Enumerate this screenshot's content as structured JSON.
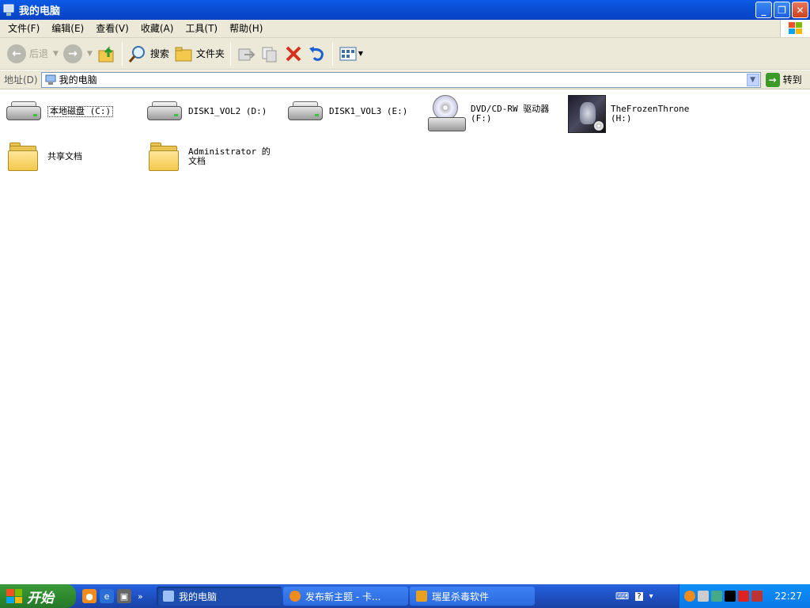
{
  "window": {
    "title": "我的电脑"
  },
  "menu": [
    "文件(F)",
    "编辑(E)",
    "查看(V)",
    "收藏(A)",
    "工具(T)",
    "帮助(H)"
  ],
  "toolbar": {
    "back": "后退",
    "search": "搜索",
    "folders": "文件夹"
  },
  "address": {
    "label": "地址(D)",
    "value": "我的电脑",
    "go": "转到"
  },
  "items": [
    {
      "name": "本地磁盘 (C:)",
      "type": "drive",
      "selected": true
    },
    {
      "name": "DISK1_VOL2 (D:)",
      "type": "drive"
    },
    {
      "name": "DISK1_VOL3 (E:)",
      "type": "drive"
    },
    {
      "name": "DVD/CD-RW 驱动器 (F:)",
      "type": "cdrom"
    },
    {
      "name": "TheFrozenThrone (H:)",
      "type": "game-disc"
    },
    {
      "name": "共享文档",
      "type": "folder"
    },
    {
      "name": "Administrator 的文档",
      "type": "folder"
    }
  ],
  "taskbar": {
    "start": "开始",
    "tasks": [
      {
        "label": "我的电脑",
        "active": true
      },
      {
        "label": "发布新主题 - 卡...",
        "active": false
      },
      {
        "label": "瑞星杀毒软件",
        "active": false
      }
    ],
    "clock": "22:27"
  },
  "colors": {
    "titlebar": "#0a4fd6",
    "taskbar": "#245edb",
    "start": "#2f8a2e",
    "tray": "#0f8ef7"
  }
}
